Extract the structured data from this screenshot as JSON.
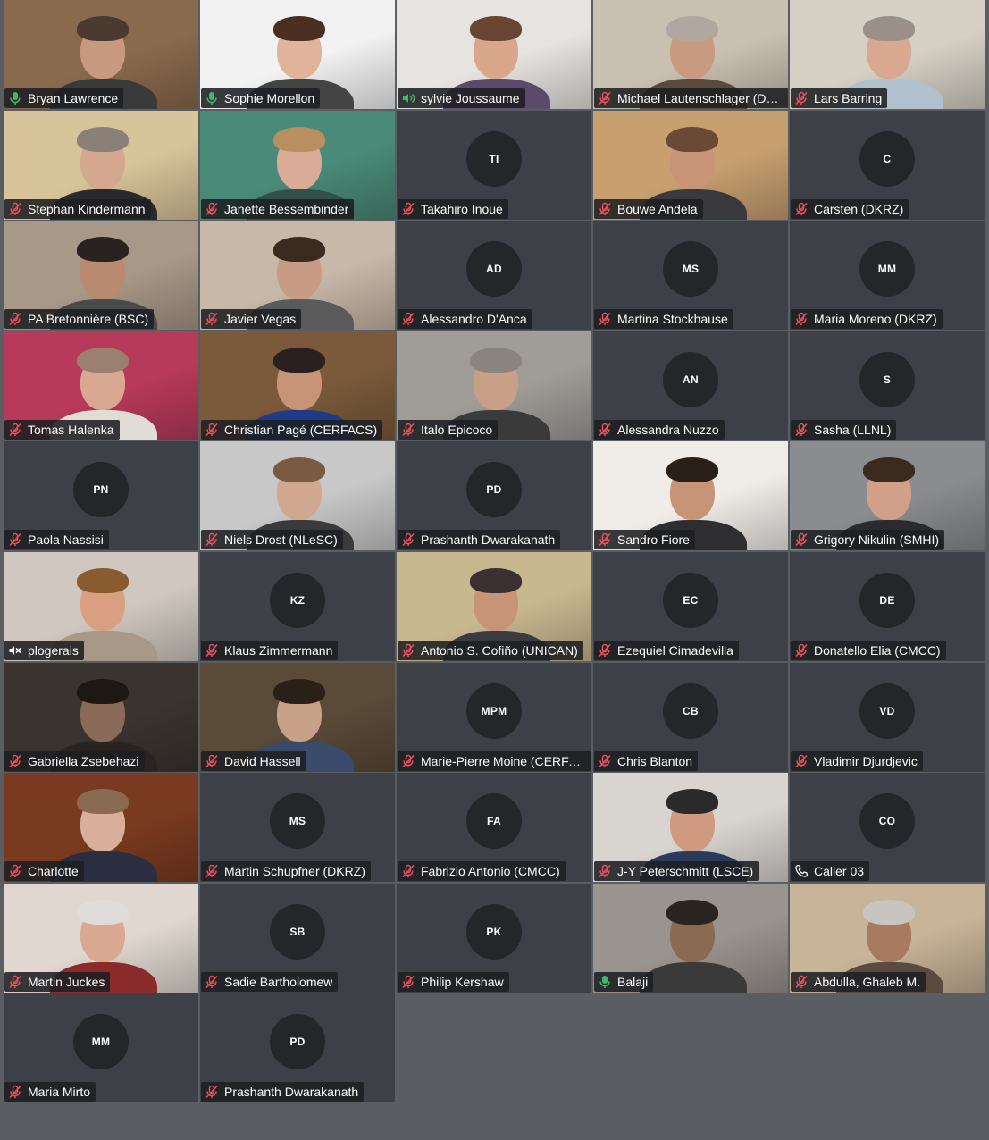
{
  "participants": [
    {
      "name": "Bryan Lawrence",
      "status": "mic-on",
      "video": true,
      "bg": "#8a6a4c",
      "skin": "#c79a80",
      "hair": "#4a3a30",
      "shirt": "#3a3a3a"
    },
    {
      "name": "Sophie Morellon",
      "status": "mic-on",
      "video": true,
      "bg": "#f2f2f2",
      "skin": "#e0b49a",
      "hair": "#4a2e20",
      "shirt": "#444444"
    },
    {
      "name": "sylvie Joussaume",
      "status": "speaking",
      "video": true,
      "bg": "#e6e4e0",
      "skin": "#d9a88c",
      "hair": "#6a4432",
      "shirt": "#5c4a6a"
    },
    {
      "name": "Michael Lautenschlager (DKRZ)",
      "status": "muted",
      "video": true,
      "bg": "#c8c0b0",
      "skin": "#c89a80",
      "hair": "#b0a8a0",
      "shirt": "#5a4a3a"
    },
    {
      "name": "Lars Barring",
      "status": "muted",
      "video": true,
      "bg": "#d6d0c4",
      "skin": "#d8a890",
      "hair": "#9a9088",
      "shirt": "#b0c0cc"
    },
    {
      "name": "Stephan Kindermann",
      "status": "muted",
      "video": true,
      "bg": "#d8c49a",
      "skin": "#d4a88e",
      "hair": "#8a8078",
      "shirt": "#2a2a2e"
    },
    {
      "name": "Janette Bessembinder",
      "status": "muted",
      "video": true,
      "bg": "#4a8a78",
      "skin": "#d8ac96",
      "hair": "#b89060",
      "shirt": "#30504a"
    },
    {
      "name": "Takahiro Inoue",
      "status": "muted",
      "video": false,
      "initials": "TI"
    },
    {
      "name": "Bouwe Andela",
      "status": "muted",
      "video": true,
      "bg": "#c8a070",
      "skin": "#c89478",
      "hair": "#6a4a34",
      "shirt": "#3a3a3e"
    },
    {
      "name": "Carsten (DKRZ)",
      "status": "muted",
      "video": false,
      "initials": "C"
    },
    {
      "name": "PA Bretonnière (BSC)",
      "status": "muted",
      "video": true,
      "bg": "#a89888",
      "skin": "#b88a70",
      "hair": "#2a2220",
      "shirt": "#4a4a4a"
    },
    {
      "name": "Javier Vegas",
      "status": "muted",
      "video": true,
      "bg": "#c8b8a8",
      "skin": "#c89c84",
      "hair": "#3a2a20",
      "shirt": "#5a5a5a"
    },
    {
      "name": "Alessandro D'Anca",
      "status": "muted",
      "video": false,
      "initials": "AD"
    },
    {
      "name": "Martina Stockhause",
      "status": "muted",
      "video": false,
      "initials": "MS"
    },
    {
      "name": "Maria Moreno (DKRZ)",
      "status": "muted",
      "video": false,
      "initials": "MM"
    },
    {
      "name": "Tomas Halenka",
      "status": "muted",
      "video": true,
      "bg": "#b83a5a",
      "skin": "#d8a890",
      "hair": "#9a8070",
      "shirt": "#e0dcd8"
    },
    {
      "name": "Christian Pagé (CERFACS)",
      "status": "muted",
      "video": true,
      "bg": "#7a5a3a",
      "skin": "#c89478",
      "hair": "#2a2020",
      "shirt": "#1e3a8a"
    },
    {
      "name": "Italo Epicoco",
      "status": "muted",
      "video": true,
      "bg": "#a09c98",
      "skin": "#c8a088",
      "hair": "#8a8480",
      "shirt": "#3a3a3a"
    },
    {
      "name": "Alessandra Nuzzo",
      "status": "muted",
      "video": false,
      "initials": "AN"
    },
    {
      "name": "Sasha (LLNL)",
      "status": "muted",
      "video": false,
      "initials": "S"
    },
    {
      "name": "Paola Nassisi",
      "status": "muted",
      "video": false,
      "initials": "PN"
    },
    {
      "name": "Niels Drost (NLeSC)",
      "status": "muted",
      "video": true,
      "bg": "#c8c8c8",
      "skin": "#d0a890",
      "hair": "#7a5a40",
      "shirt": "#3a3a3a"
    },
    {
      "name": "Prashanth Dwarakanath",
      "status": "muted",
      "video": false,
      "initials": "PD"
    },
    {
      "name": "Sandro Fiore",
      "status": "muted",
      "video": true,
      "bg": "#f0ece8",
      "skin": "#c89478",
      "hair": "#2a1e18",
      "shirt": "#2e2e30"
    },
    {
      "name": "Grigory Nikulin (SMHI)",
      "status": "muted",
      "video": true,
      "bg": "#8a8c90",
      "skin": "#d0a088",
      "hair": "#3a2a20",
      "shirt": "#2a2a30"
    },
    {
      "name": "plogerais",
      "status": "speaker-off",
      "video": true,
      "bg": "#d0c8c0",
      "skin": "#d8a080",
      "hair": "#8a5a30",
      "shirt": "#a89888"
    },
    {
      "name": "Klaus Zimmermann",
      "status": "muted",
      "video": false,
      "initials": "KZ"
    },
    {
      "name": "Antonio S. Cofiño (UNICAN)",
      "status": "muted",
      "video": true,
      "bg": "#c8b890",
      "skin": "#c89478",
      "hair": "#3a3030",
      "shirt": "#3a3a40"
    },
    {
      "name": "Ezequiel Cimadevilla",
      "status": "muted",
      "video": false,
      "initials": "EC"
    },
    {
      "name": "Donatello Elia (CMCC)",
      "status": "muted",
      "video": false,
      "initials": "DE"
    },
    {
      "name": "Gabriella Zsebehazi",
      "status": "muted",
      "video": true,
      "bg": "#3a3430",
      "skin": "#8a6a58",
      "hair": "#1e1814",
      "shirt": "#2a2420"
    },
    {
      "name": "David Hassell",
      "status": "muted",
      "video": true,
      "bg": "#5a4a38",
      "skin": "#c8a088",
      "hair": "#2a2018",
      "shirt": "#3a4a6a"
    },
    {
      "name": "Marie-Pierre Moine (CERFACS)",
      "status": "muted",
      "video": false,
      "initials": "MPM"
    },
    {
      "name": "Chris Blanton",
      "status": "muted",
      "video": false,
      "initials": "CB"
    },
    {
      "name": "Vladimir Djurdjevic",
      "status": "muted",
      "video": false,
      "initials": "VD"
    },
    {
      "name": "Charlotte",
      "status": "muted",
      "video": true,
      "bg": "#7a3a20",
      "skin": "#d8b09a",
      "hair": "#8a6a50",
      "shirt": "#2a2e40"
    },
    {
      "name": "Martin Schupfner (DKRZ)",
      "status": "muted",
      "video": false,
      "initials": "MS"
    },
    {
      "name": "Fabrizio Antonio (CMCC)",
      "status": "muted",
      "video": false,
      "initials": "FA"
    },
    {
      "name": "J-Y Peterschmitt (LSCE)",
      "status": "muted",
      "video": true,
      "bg": "#d8d4d0",
      "skin": "#d09a80",
      "hair": "#2a2a2a",
      "shirt": "#2a3a5a"
    },
    {
      "name": "Caller 03",
      "status": "phone",
      "video": false,
      "initials": "CO"
    },
    {
      "name": "Martin Juckes",
      "status": "muted",
      "video": true,
      "bg": "#e0d8d0",
      "skin": "#d8a890",
      "hair": "#e0dcd8",
      "shirt": "#8a2a2a"
    },
    {
      "name": "Sadie Bartholomew",
      "status": "muted",
      "video": false,
      "initials": "SB"
    },
    {
      "name": "Philip Kershaw",
      "status": "muted",
      "video": false,
      "initials": "PK"
    },
    {
      "name": "Balaji",
      "status": "mic-on",
      "video": true,
      "bg": "#9a9490",
      "skin": "#8a6a50",
      "hair": "#2a2420",
      "shirt": "#3a3a3a"
    },
    {
      "name": "Abdulla, Ghaleb M.",
      "status": "muted",
      "video": true,
      "bg": "#c8b498",
      "skin": "#a87a60",
      "hair": "#c8c4c0",
      "shirt": "#5a4a40"
    },
    {
      "name": "Maria Mirto",
      "status": "muted",
      "video": false,
      "initials": "MM"
    },
    {
      "name": "Prashanth Dwarakanath",
      "status": "muted",
      "video": false,
      "initials": "PD"
    }
  ],
  "colors": {
    "muted": "#e8505b",
    "mic_on": "#3fb868",
    "background": "#5a5d62",
    "tile": "#3d4046",
    "avatar": "#24262a"
  }
}
